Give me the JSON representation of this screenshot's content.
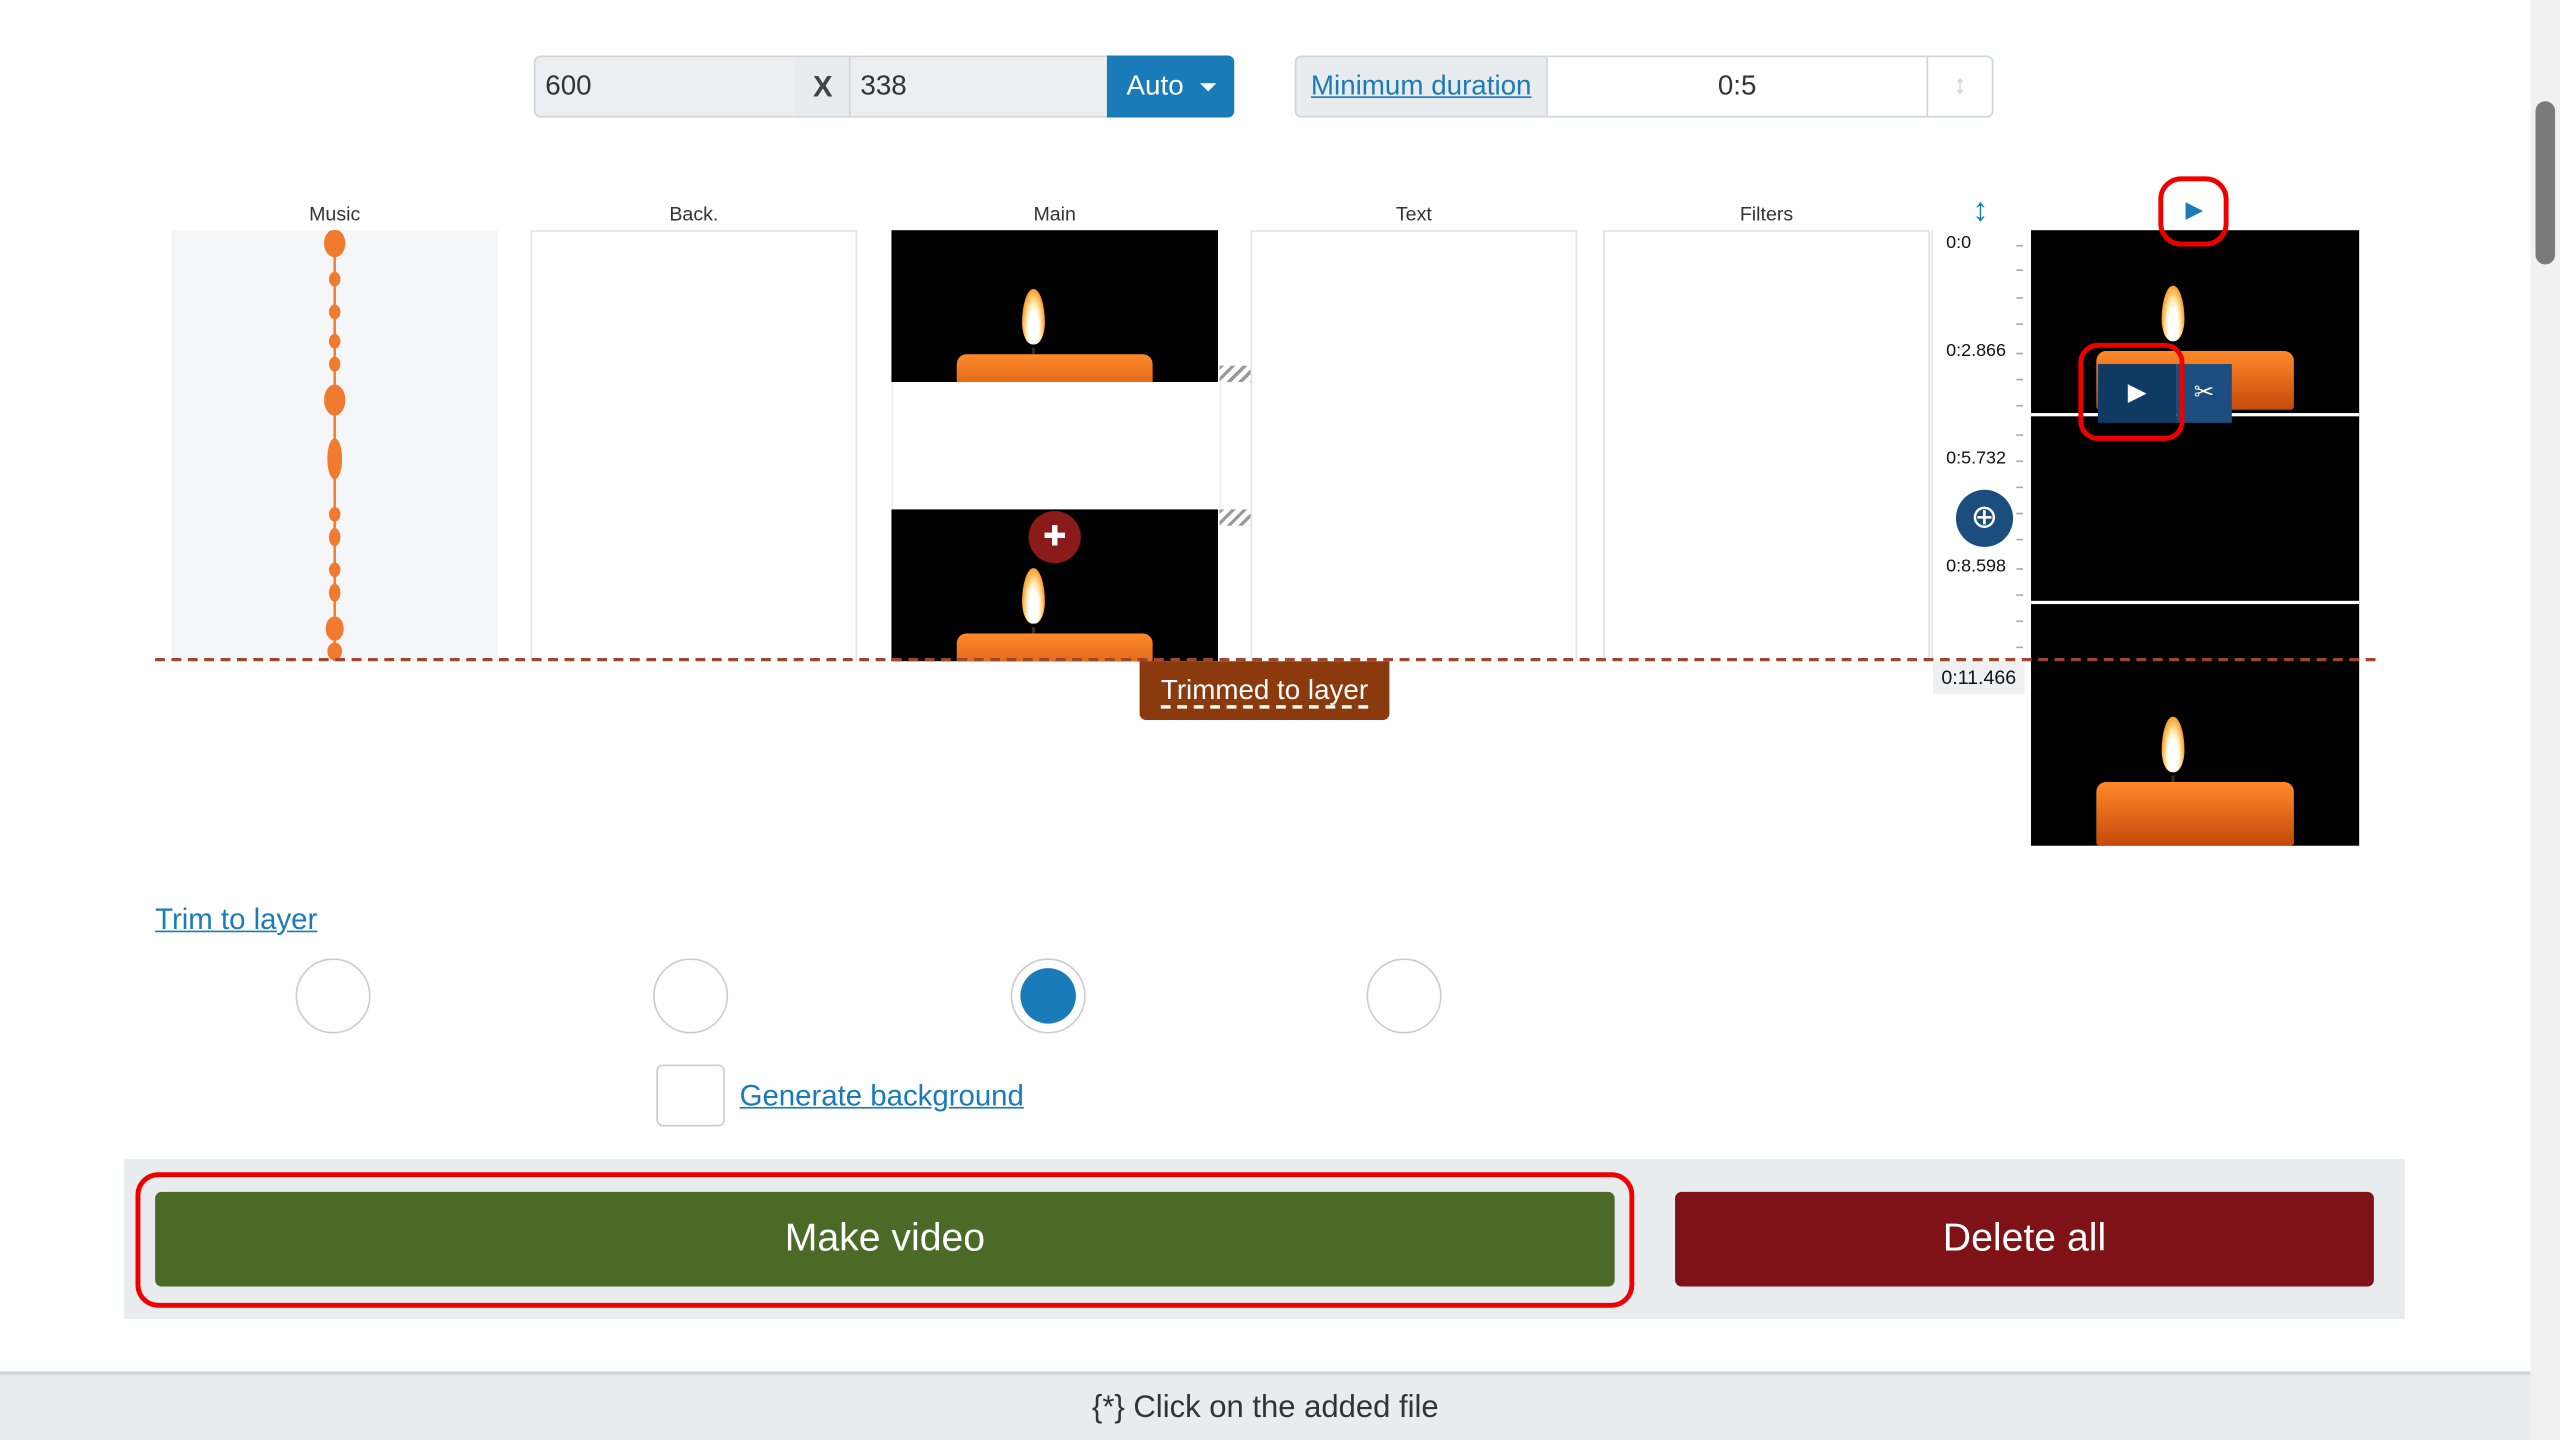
{
  "size": {
    "width": "600",
    "x_label": "X",
    "height": "338",
    "mode": "Auto"
  },
  "duration": {
    "label": "Minimum duration",
    "value": "0:5"
  },
  "columns": [
    "Music",
    "Back.",
    "Main",
    "Text",
    "Filters"
  ],
  "ruler": {
    "ticks": [
      "0:0",
      "0:2.866",
      "0:5.732",
      "0:8.598"
    ],
    "end": "0:11.466"
  },
  "trim_tag": "Trimmed to layer",
  "trim_link": "Trim to layer",
  "radio_selected_index": 2,
  "generate_background": "Generate background",
  "buttons": {
    "make": "Make video",
    "delete": "Delete all"
  },
  "footer": "{*} Click on the added file",
  "colors": {
    "accent": "#1a7bb9",
    "make": "#4b6a26",
    "delete": "#7e1216",
    "wave": "#f07a2e",
    "highlight": "#e00000"
  }
}
